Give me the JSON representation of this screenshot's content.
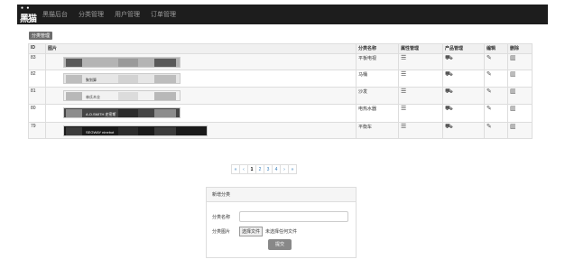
{
  "nav": {
    "logo_text": "黑猫",
    "brand": "黑猫后台",
    "items": [
      "分类管理",
      "用户管理",
      "订单管理"
    ]
  },
  "section_title": "分类管理",
  "table": {
    "headers": [
      "ID",
      "图片",
      "分类名称",
      "属性管理",
      "产品管理",
      "编辑",
      "删除"
    ],
    "rows": [
      {
        "id": "83",
        "name": "平板电视",
        "banner_text": "",
        "banner_style": "tv"
      },
      {
        "id": "82",
        "name": "马桶",
        "banner_text": "聚划算",
        "banner_style": "toilet"
      },
      {
        "id": "81",
        "name": "沙发",
        "banner_text": "林氏木业",
        "banner_style": "sofa"
      },
      {
        "id": "80",
        "name": "电热水器",
        "banner_text": "A.O.SMITH 史密斯",
        "banner_style": "heater"
      },
      {
        "id": "79",
        "name": "平衡车",
        "banner_text": "SEGWAY ninebot",
        "banner_style": "segway"
      }
    ]
  },
  "pagination": [
    "«",
    "‹",
    "1",
    "2",
    "3",
    "4",
    "›",
    "»"
  ],
  "pagination_active": "1",
  "form": {
    "title": "新增分类",
    "name_label": "分类名称",
    "name_value": "",
    "image_label": "分类图片",
    "file_button": "选择文件",
    "file_status": "未选择任何文件",
    "submit": "提交"
  },
  "icons": {
    "property": "list-icon",
    "product": "cart-icon",
    "edit": "edit-icon",
    "delete": "trash-icon"
  },
  "colors": {
    "navbar": "#1d1d1d",
    "nav_text": "#9d9d9d",
    "link": "#337ab7",
    "submit": "#888888"
  }
}
